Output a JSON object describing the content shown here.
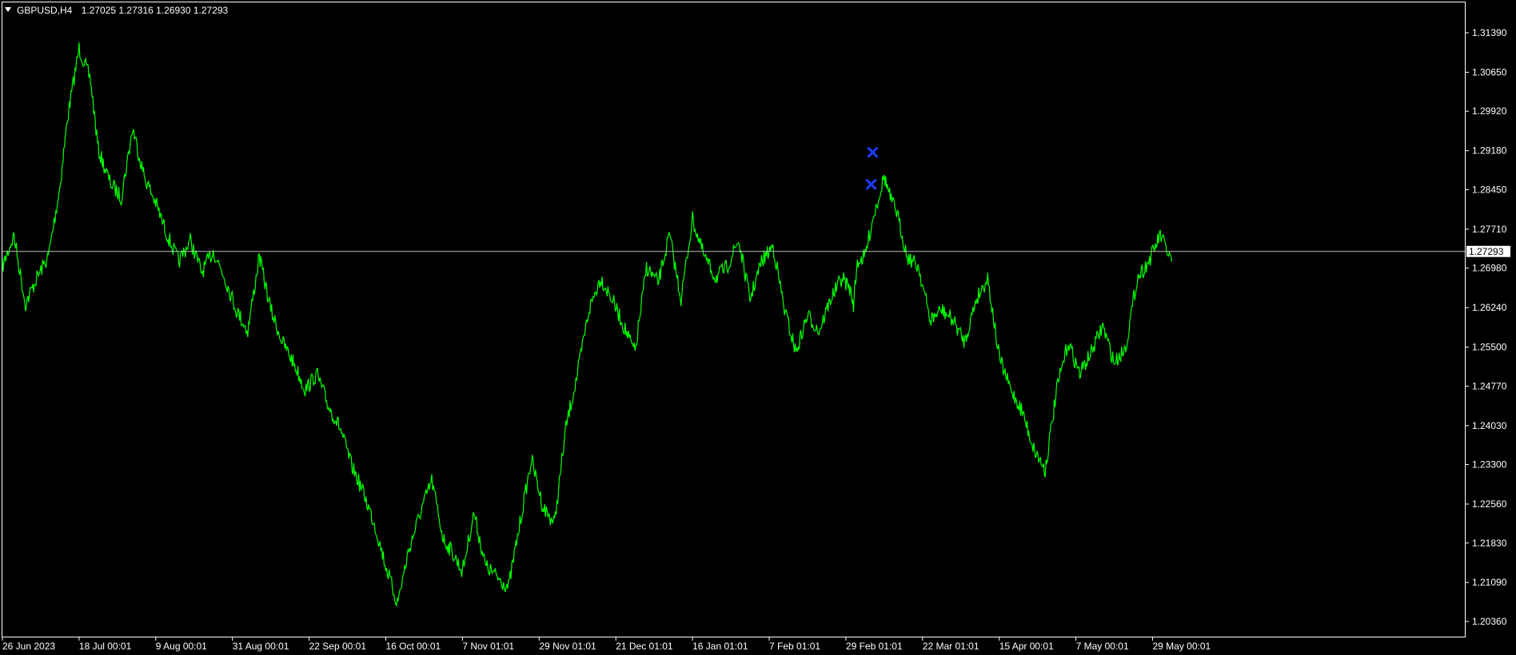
{
  "header": {
    "symbol": "GBPUSD,H4",
    "ohlc": "1.27025 1.27316 1.26930 1.27293"
  },
  "colors": {
    "background": "#000000",
    "price_line": "#00ff00",
    "axis": "#ffffff",
    "marker": "#1e3cff",
    "current_price_label_bg": "#ffffff",
    "current_price_label_text": "#000000"
  },
  "chart_data": {
    "type": "line",
    "ylim": [
      1.2,
      1.318
    ],
    "yticks": [
      "1.31390",
      "1.30650",
      "1.29920",
      "1.29180",
      "1.28450",
      "1.27710",
      "1.26980",
      "1.26240",
      "1.25500",
      "1.24770",
      "1.24030",
      "1.23300",
      "1.22560",
      "1.21830",
      "1.21090",
      "1.20360"
    ],
    "current_price": "1.27293",
    "x_labels": [
      "26 Jun 2023",
      "18 Jul 00:01",
      "9 Aug 00:01",
      "31 Aug 00:01",
      "22 Sep 00:01",
      "16 Oct 00:01",
      "7 Nov 01:01",
      "29 Nov 01:01",
      "21 Dec 01:01",
      "16 Jan 01:01",
      "7 Feb 01:01",
      "29 Feb 01:01",
      "22 Mar 01:01",
      "15 Apr 00:01",
      "7 May 00:01",
      "29 May 00:01"
    ],
    "grid": false,
    "series": [
      {
        "x": [
          0,
          0.15,
          0.3,
          0.45,
          0.6,
          0.75,
          0.85,
          1.0,
          1.15,
          1.25,
          1.4,
          1.55,
          1.7,
          1.85,
          2.0,
          2.15,
          2.3,
          2.45,
          2.6,
          2.75,
          2.9,
          3.05,
          3.2,
          3.35,
          3.5,
          3.65,
          3.8,
          3.95,
          4.1,
          4.25,
          4.4,
          4.55,
          4.7,
          4.85,
          5.0,
          5.15,
          5.3,
          5.45,
          5.6,
          5.75,
          5.85,
          6.0,
          6.15,
          6.3,
          6.45,
          6.6,
          6.75,
          6.9,
          7.05,
          7.2,
          7.35,
          7.5,
          7.65,
          7.8,
          7.95,
          8.1,
          8.25,
          8.4,
          8.55,
          8.7,
          8.85,
          9.0,
          9.15,
          9.3,
          9.45,
          9.6,
          9.75,
          9.9,
          10.05,
          10.2,
          10.35,
          10.5,
          10.65,
          10.8,
          10.95,
          11.05,
          11.1,
          11.15,
          11.25,
          11.35,
          11.5,
          11.6,
          11.65,
          11.8,
          11.95,
          12.1,
          12.25,
          12.4,
          12.55,
          12.7,
          12.85,
          13.0,
          13.15,
          13.3,
          13.45,
          13.6,
          13.75,
          13.9,
          14.05,
          14.2,
          14.35,
          14.5,
          14.65,
          14.8,
          14.95,
          15.1,
          15.25
        ],
        "values": [
          1.27,
          1.276,
          1.263,
          1.268,
          1.272,
          1.285,
          1.298,
          1.311,
          1.305,
          1.292,
          1.286,
          1.283,
          1.296,
          1.287,
          1.282,
          1.276,
          1.271,
          1.275,
          1.269,
          1.273,
          1.268,
          1.262,
          1.258,
          1.272,
          1.262,
          1.256,
          1.252,
          1.247,
          1.25,
          1.244,
          1.24,
          1.233,
          1.228,
          1.222,
          1.214,
          1.207,
          1.217,
          1.224,
          1.23,
          1.219,
          1.217,
          1.213,
          1.224,
          1.214,
          1.212,
          1.21,
          1.222,
          1.234,
          1.225,
          1.222,
          1.24,
          1.25,
          1.262,
          1.268,
          1.264,
          1.259,
          1.254,
          1.27,
          1.267,
          1.276,
          1.264,
          1.279,
          1.272,
          1.268,
          1.27,
          1.275,
          1.264,
          1.271,
          1.274,
          1.262,
          1.254,
          1.261,
          1.258,
          1.264,
          1.268,
          1.266,
          1.263,
          1.271,
          1.272,
          1.279,
          1.287,
          1.282,
          1.281,
          1.272,
          1.27,
          1.26,
          1.262,
          1.26,
          1.256,
          1.264,
          1.268,
          1.253,
          1.247,
          1.243,
          1.236,
          1.232,
          1.247,
          1.256,
          1.25,
          1.254,
          1.259,
          1.252,
          1.255,
          1.268,
          1.271,
          1.276,
          1.271
        ],
        "markers": [
          {
            "x": 11.35,
            "y": 1.2915
          },
          {
            "x": 11.33,
            "y": 1.2855
          }
        ]
      }
    ]
  }
}
